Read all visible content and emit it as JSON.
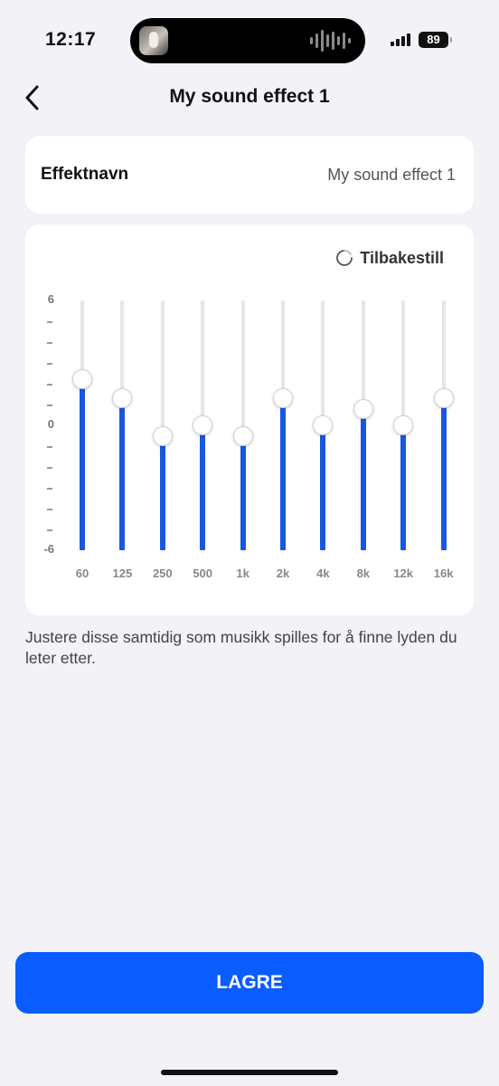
{
  "status_bar": {
    "time": "12:17",
    "battery": "89"
  },
  "header": {
    "title": "My sound effect 1"
  },
  "effect_name": {
    "label": "Effektnavn",
    "value": "My sound effect 1"
  },
  "equalizer": {
    "reset_label": "Tilbakestill",
    "y_axis": {
      "top_label": "6",
      "mid_label": "0",
      "bottom_label": "-6",
      "tick_mark": "-",
      "min": -6,
      "max": 6
    },
    "bands": [
      {
        "label": "60",
        "value": 2.2
      },
      {
        "label": "125",
        "value": 1.3
      },
      {
        "label": "250",
        "value": -0.5
      },
      {
        "label": "500",
        "value": 0
      },
      {
        "label": "1k",
        "value": -0.5
      },
      {
        "label": "2k",
        "value": 1.3
      },
      {
        "label": "4k",
        "value": 0
      },
      {
        "label": "8k",
        "value": 0.8
      },
      {
        "label": "12k",
        "value": 0
      },
      {
        "label": "16k",
        "value": 1.3
      }
    ]
  },
  "hint_text": "Justere disse samtidig som musikk spilles for å finne lyden du leter etter.",
  "save_button": {
    "label": "LAGRE"
  },
  "colors": {
    "accent": "#0a5cff",
    "slider_fill": "#1a57e0",
    "background": "#f2f2f7"
  }
}
